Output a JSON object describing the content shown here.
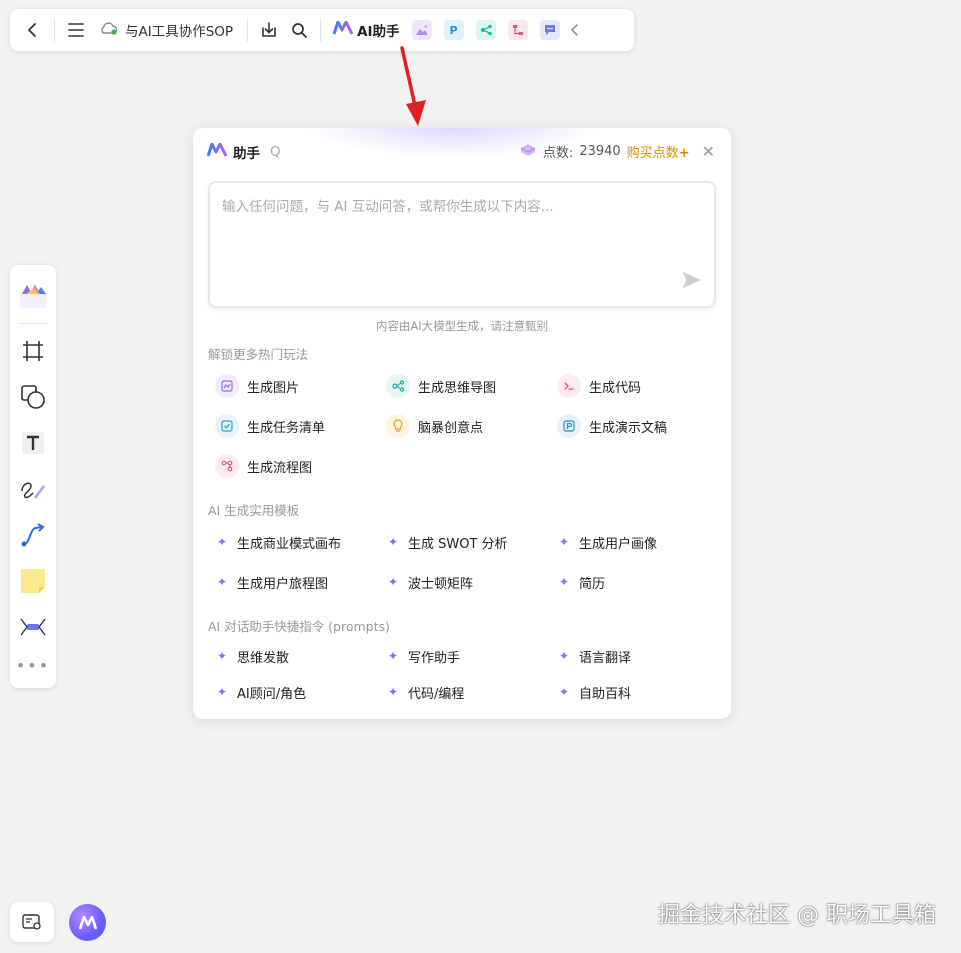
{
  "toolbar": {
    "doc_title": "与AI工具协作SOP",
    "ai_label": "AI助手"
  },
  "panel": {
    "title": "助手",
    "title_suffix": "Q",
    "points_label": "点数:",
    "points_value": "23940",
    "buy_label": "购买点数",
    "buy_plus": "+",
    "input_placeholder": "输入任何问题，与 AI 互动问答，或帮你生成以下内容...",
    "disclaimer": "内容由AI大模型生成，请注意甄别",
    "section_hot": "解锁更多热门玩法",
    "hot_items": [
      {
        "label": "生成图片",
        "icon": "image-icon",
        "color": "#8e6cf6",
        "bg": "#f1ecff"
      },
      {
        "label": "生成思维导图",
        "icon": "mindmap-icon",
        "color": "#16b39a",
        "bg": "#e4f7f3"
      },
      {
        "label": "生成代码",
        "icon": "code-icon",
        "color": "#e0566b",
        "bg": "#fdecef"
      },
      {
        "label": "生成任务清单",
        "icon": "checklist-icon",
        "color": "#2aa1d8",
        "bg": "#e6f4fb"
      },
      {
        "label": "脑暴创意点",
        "icon": "lightbulb-icon",
        "color": "#f0a020",
        "bg": "#fff4e0"
      },
      {
        "label": "生成演示文稿",
        "icon": "presentation-icon",
        "color": "#2a8fd8",
        "bg": "#e6f1fb"
      },
      {
        "label": "生成流程图",
        "icon": "flowchart-icon",
        "color": "#e0566b",
        "bg": "#fdecef"
      }
    ],
    "section_templates": "AI 生成实用模板",
    "templates": [
      "生成商业模式画布",
      "生成 SWOT 分析",
      "生成用户画像",
      "生成用户旅程图",
      "波士顿矩阵",
      "简历"
    ],
    "section_prompts": "AI 对话助手快捷指令 (prompts)",
    "prompts": [
      "思维发散",
      "写作助手",
      "语言翻译",
      "AI顾问/角色",
      "代码/编程",
      "自助百科"
    ]
  },
  "watermark": "掘金技术社区 @ 职场工具箱",
  "colors": {
    "accent": "#8e6cf6",
    "buy": "#e08a00",
    "arrow": "#e02020"
  }
}
